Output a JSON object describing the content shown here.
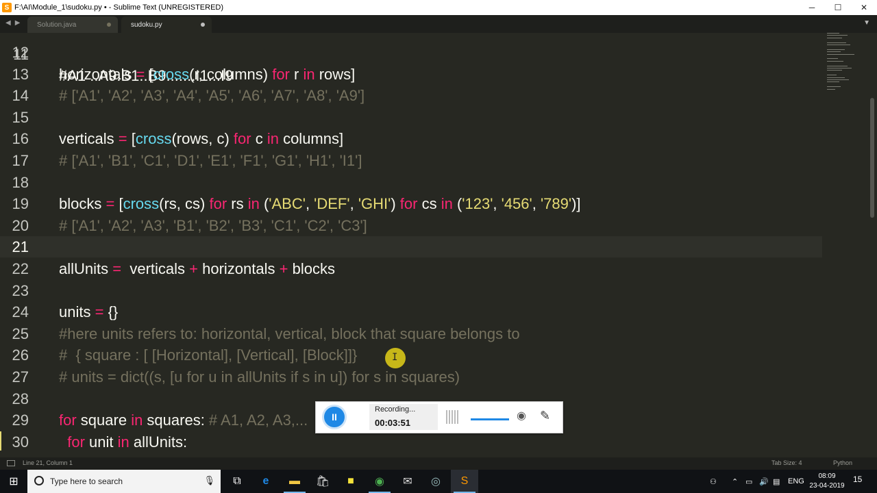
{
  "window": {
    "title": "F:\\AI\\Module_1\\sudoku.py • - Sublime Text (UNREGISTERED)",
    "controls": {
      "minimize": "─",
      "maximize": "☐",
      "close": "✕"
    }
  },
  "tabs": [
    {
      "label": "Solution.java"
    },
    {
      "label": "sudoku.py"
    }
  ],
  "editor": {
    "top_partial": "#A1 ..A9.B1..B9.......I1...I9",
    "lines": [
      {
        "n": "12",
        "tokens": []
      },
      {
        "n": "13",
        "tokens": [
          [
            "horizontals ",
            ""
          ],
          [
            "=",
            "kw"
          ],
          [
            " [",
            ""
          ],
          [
            "cross",
            "fn"
          ],
          [
            "(r, columns) ",
            ""
          ],
          [
            "for",
            "kw"
          ],
          [
            " r ",
            ""
          ],
          [
            "in",
            "kw"
          ],
          [
            " rows]",
            ""
          ]
        ]
      },
      {
        "n": "14",
        "tokens": [
          [
            "# ['A1', 'A2', 'A3', 'A4', 'A5', 'A6', 'A7', 'A8', 'A9']",
            "cm"
          ]
        ]
      },
      {
        "n": "15",
        "tokens": []
      },
      {
        "n": "16",
        "tokens": [
          [
            "verticals ",
            ""
          ],
          [
            "=",
            "kw"
          ],
          [
            " [",
            ""
          ],
          [
            "cross",
            "fn"
          ],
          [
            "(rows, c) ",
            ""
          ],
          [
            "for",
            "kw"
          ],
          [
            " c ",
            ""
          ],
          [
            "in",
            "kw"
          ],
          [
            " columns]",
            ""
          ]
        ]
      },
      {
        "n": "17",
        "tokens": [
          [
            "# ['A1', 'B1', 'C1', 'D1', 'E1', 'F1', 'G1', 'H1', 'I1']",
            "cm"
          ]
        ]
      },
      {
        "n": "18",
        "tokens": []
      },
      {
        "n": "19",
        "tokens": [
          [
            "blocks ",
            ""
          ],
          [
            "=",
            "kw"
          ],
          [
            " [",
            ""
          ],
          [
            "cross",
            "fn"
          ],
          [
            "(rs, cs) ",
            ""
          ],
          [
            "for",
            "kw"
          ],
          [
            " rs ",
            ""
          ],
          [
            "in",
            "kw"
          ],
          [
            " (",
            ""
          ],
          [
            "'ABC'",
            "st"
          ],
          [
            ", ",
            ""
          ],
          [
            "'DEF'",
            "st"
          ],
          [
            ", ",
            ""
          ],
          [
            "'GHI'",
            "st"
          ],
          [
            ") ",
            ""
          ],
          [
            "for",
            "kw"
          ],
          [
            " cs ",
            ""
          ],
          [
            "in",
            "kw"
          ],
          [
            " (",
            ""
          ],
          [
            "'123'",
            "st"
          ],
          [
            ", ",
            ""
          ],
          [
            "'456'",
            "st"
          ],
          [
            ", ",
            ""
          ],
          [
            "'789'",
            "st"
          ],
          [
            ")]",
            ""
          ]
        ]
      },
      {
        "n": "20",
        "tokens": [
          [
            "# ['A1', 'A2', 'A3', 'B1', 'B2', 'B3', 'C1', 'C2', 'C3']",
            "cm"
          ]
        ]
      },
      {
        "n": "21",
        "tokens": [],
        "current": true
      },
      {
        "n": "22",
        "tokens": [
          [
            "allUnits ",
            ""
          ],
          [
            "=",
            "kw"
          ],
          [
            "  verticals ",
            ""
          ],
          [
            "+",
            "kw"
          ],
          [
            " horizontals ",
            ""
          ],
          [
            "+",
            "kw"
          ],
          [
            " blocks",
            ""
          ]
        ]
      },
      {
        "n": "23",
        "tokens": []
      },
      {
        "n": "24",
        "tokens": [
          [
            "units ",
            ""
          ],
          [
            "=",
            "kw"
          ],
          [
            " {}",
            ""
          ]
        ]
      },
      {
        "n": "25",
        "tokens": [
          [
            "#here units refers to: horizontal, vertical, block that square belongs to",
            "cm"
          ]
        ]
      },
      {
        "n": "26",
        "tokens": [
          [
            "#  { square : [ [Horizontal], [Vertical], [Block]]}",
            "cm"
          ]
        ]
      },
      {
        "n": "27",
        "tokens": [
          [
            "# units = dict((s, [u for u in allUnits if s in u]) for s in squares)",
            "cm"
          ]
        ]
      },
      {
        "n": "28",
        "tokens": []
      },
      {
        "n": "29",
        "tokens": [
          [
            "for",
            "kw"
          ],
          [
            " square ",
            ""
          ],
          [
            "in",
            "kw"
          ],
          [
            " squares: ",
            ""
          ],
          [
            "# A1, A2, A3,...",
            "cm"
          ]
        ]
      },
      {
        "n": "30",
        "tokens": [
          [
            "  ",
            ""
          ],
          [
            "for",
            "kw"
          ],
          [
            " unit ",
            ""
          ],
          [
            "in",
            "kw"
          ],
          [
            " allUnits:",
            ""
          ]
        ]
      }
    ]
  },
  "recorder": {
    "status": "Recording...",
    "time": "00:03:51",
    "pause_label": "II"
  },
  "statusbar": {
    "position": "Line 21, Column 1",
    "tab_size": "Tab Size: 4",
    "syntax": "Python"
  },
  "taskbar": {
    "search_placeholder": "Type here to search",
    "language": "ENG",
    "time": "08:09",
    "date": "23-04-2019",
    "notification_count": "15"
  },
  "colors": {
    "background": "#272822",
    "keyword": "#f92672",
    "function": "#66d9ef",
    "string": "#e6db74",
    "comment": "#75715e"
  }
}
